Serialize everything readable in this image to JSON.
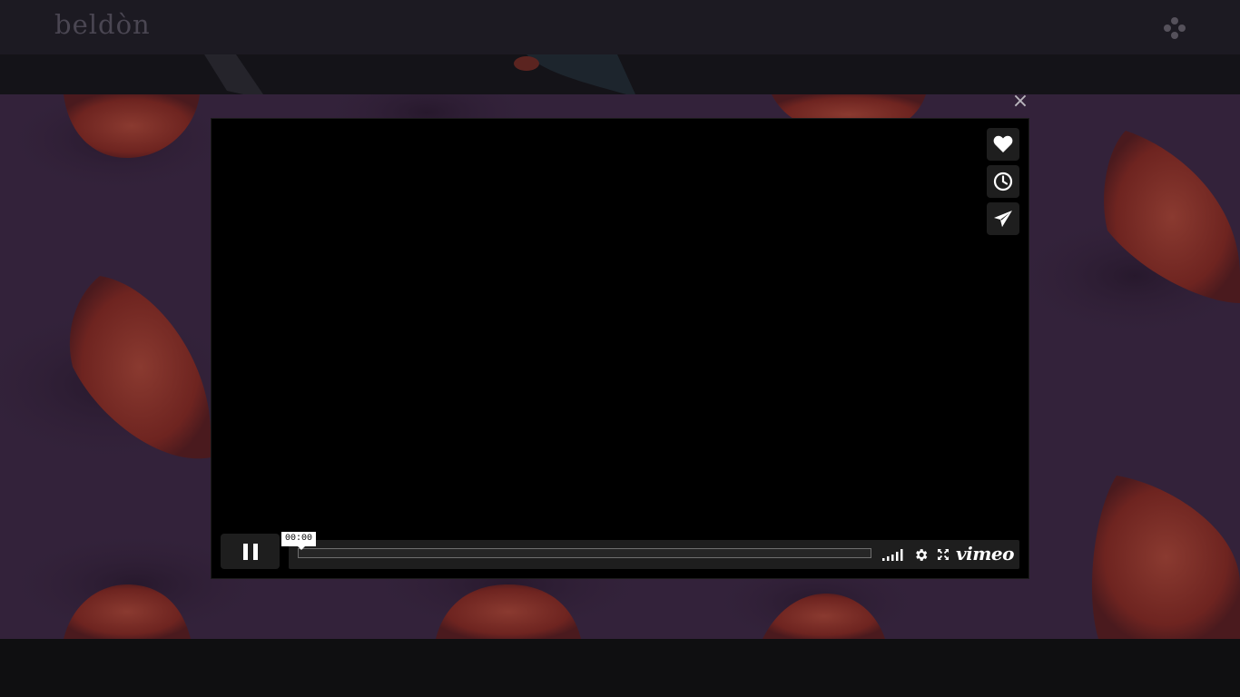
{
  "site": {
    "logo_text": "beldòn",
    "menu_icon": "dots-menu-icon"
  },
  "overlay": {
    "close_label": "×"
  },
  "player": {
    "side_buttons": [
      {
        "name": "like-button",
        "icon": "heart-icon"
      },
      {
        "name": "watch-later-button",
        "icon": "clock-icon"
      },
      {
        "name": "share-button",
        "icon": "paper-plane-icon"
      }
    ],
    "play_state_icon": "pause-icon",
    "current_time": "00:00",
    "progress_fraction": 0.0,
    "controls": {
      "volume_icon": "volume-bars-icon",
      "settings_icon": "gear-icon",
      "fullscreen_icon": "fullscreen-icon",
      "brand_label": "vimeo"
    }
  },
  "colors": {
    "hero_background": "#33223a",
    "fruit": "#7a2a24",
    "player_background": "#000000",
    "control_background": "#1e1e1e"
  }
}
